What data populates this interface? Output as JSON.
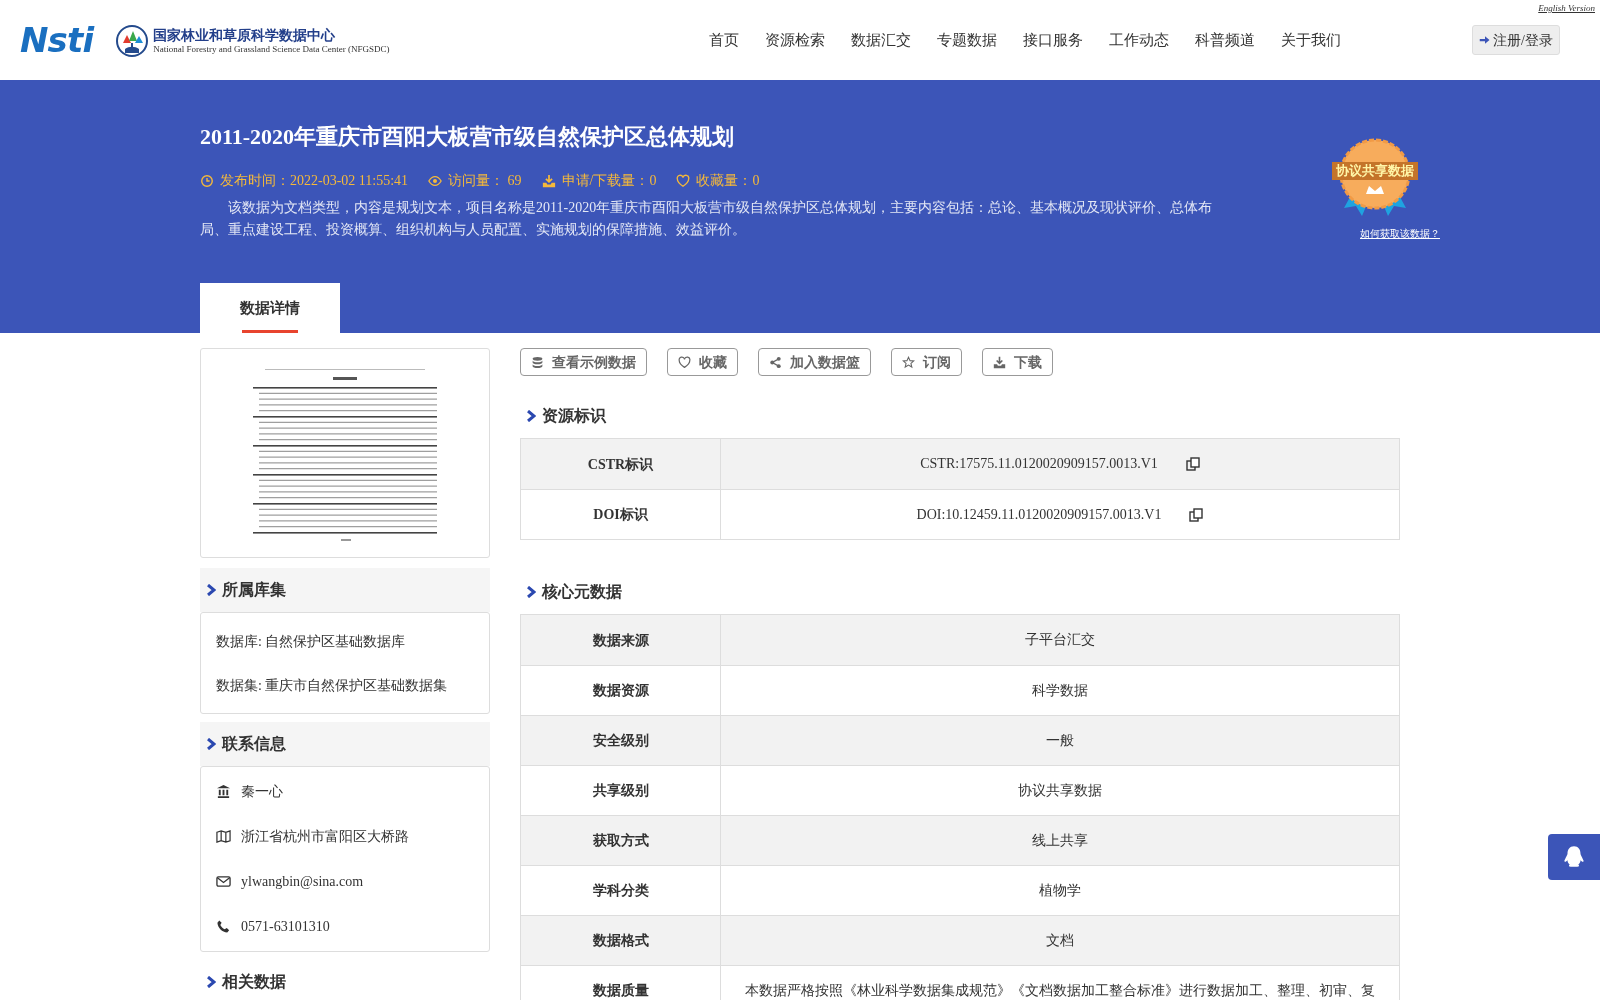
{
  "header": {
    "logo_text": "Nsti",
    "org_name": "国家林业和草原科学数据中心",
    "org_subtitle": "National Forestry and Grassland Science Data Center (NFGSDC)",
    "english_link": "English Version",
    "login_button": "注册/登录",
    "nav": [
      {
        "label": "首页",
        "selected": false
      },
      {
        "label": "资源检索",
        "selected": false
      },
      {
        "label": "数据汇交",
        "selected": false
      },
      {
        "label": "专题数据",
        "selected": false
      },
      {
        "label": "接口服务",
        "selected": false
      },
      {
        "label": "工作动态",
        "selected": false
      },
      {
        "label": "科普频道",
        "selected": false
      },
      {
        "label": "关于我们",
        "selected": false
      }
    ]
  },
  "banner": {
    "title": "2011-2020年重庆市酉阳大板营市级自然保护区总体规划",
    "meta": [
      {
        "kind": "clock",
        "text": "发布时间：2022-03-02 11:55:41"
      },
      {
        "kind": "eye",
        "text": "访问量： 69"
      },
      {
        "kind": "download",
        "text": "申请/下载量：0"
      },
      {
        "kind": "heart",
        "text": "收藏量：0"
      }
    ],
    "description": "该数据为文档类型，内容是规划文本，项目名称是2011-2020年重庆市酉阳大板营市级自然保护区总体规划，主要内容包括：总论、基本概况及现状评价、总体布局、重点建设工程、投资概算、组织机构与人员配置、实施规划的保障措施、效益评价。",
    "badge": {
      "text": "协议共享数据",
      "link": "如何获取该数据？"
    }
  },
  "tabs": [
    {
      "label": "数据详情",
      "selected": true
    }
  ],
  "sidebar": {
    "collection": {
      "title": "所属库集",
      "items": [
        "数据库: 自然保护区基础数据库",
        "数据集: 重庆市自然保护区基础数据集"
      ]
    },
    "contact": {
      "title": "联系信息",
      "items": [
        {
          "kind": "institution",
          "text": "秦一心"
        },
        {
          "kind": "map",
          "text": "浙江省杭州市富阳区大桥路"
        },
        {
          "kind": "email",
          "text": "ylwangbin@sina.com"
        },
        {
          "kind": "phone",
          "text": "0571-63101310"
        }
      ]
    },
    "related": {
      "title": "相关数据"
    }
  },
  "actions": [
    {
      "kind": "database",
      "label": "查看示例数据"
    },
    {
      "kind": "heart",
      "label": "收藏"
    },
    {
      "kind": "share",
      "label": "加入数据篮"
    },
    {
      "kind": "star",
      "label": "订阅"
    },
    {
      "kind": "download",
      "label": "下载"
    }
  ],
  "sections": [
    {
      "title": "资源标识",
      "rows": [
        {
          "label": "CSTR标识",
          "value": "CSTR:17575.11.0120020909157.0013.V1",
          "copyable": true
        },
        {
          "label": "DOI标识",
          "value": "DOI:10.12459.11.0120020909157.0013.V1",
          "copyable": true
        }
      ]
    },
    {
      "title": "核心元数据",
      "rows": [
        {
          "label": "数据来源",
          "value": "子平台汇交",
          "copyable": false
        },
        {
          "label": "数据资源",
          "value": "科学数据",
          "copyable": false
        },
        {
          "label": "安全级别",
          "value": "一般",
          "copyable": false
        },
        {
          "label": "共享级别",
          "value": "协议共享数据",
          "copyable": false
        },
        {
          "label": "获取方式",
          "value": "线上共享",
          "copyable": false
        },
        {
          "label": "学科分类",
          "value": "植物学",
          "copyable": false
        },
        {
          "label": "数据格式",
          "value": "文档",
          "copyable": false
        },
        {
          "label": "数据质量",
          "value": "本数据严格按照《林业科学数据集成规范》《文档数据加工整合标准》进行数据加工、整理、初审、复",
          "copyable": false
        }
      ]
    }
  ]
}
